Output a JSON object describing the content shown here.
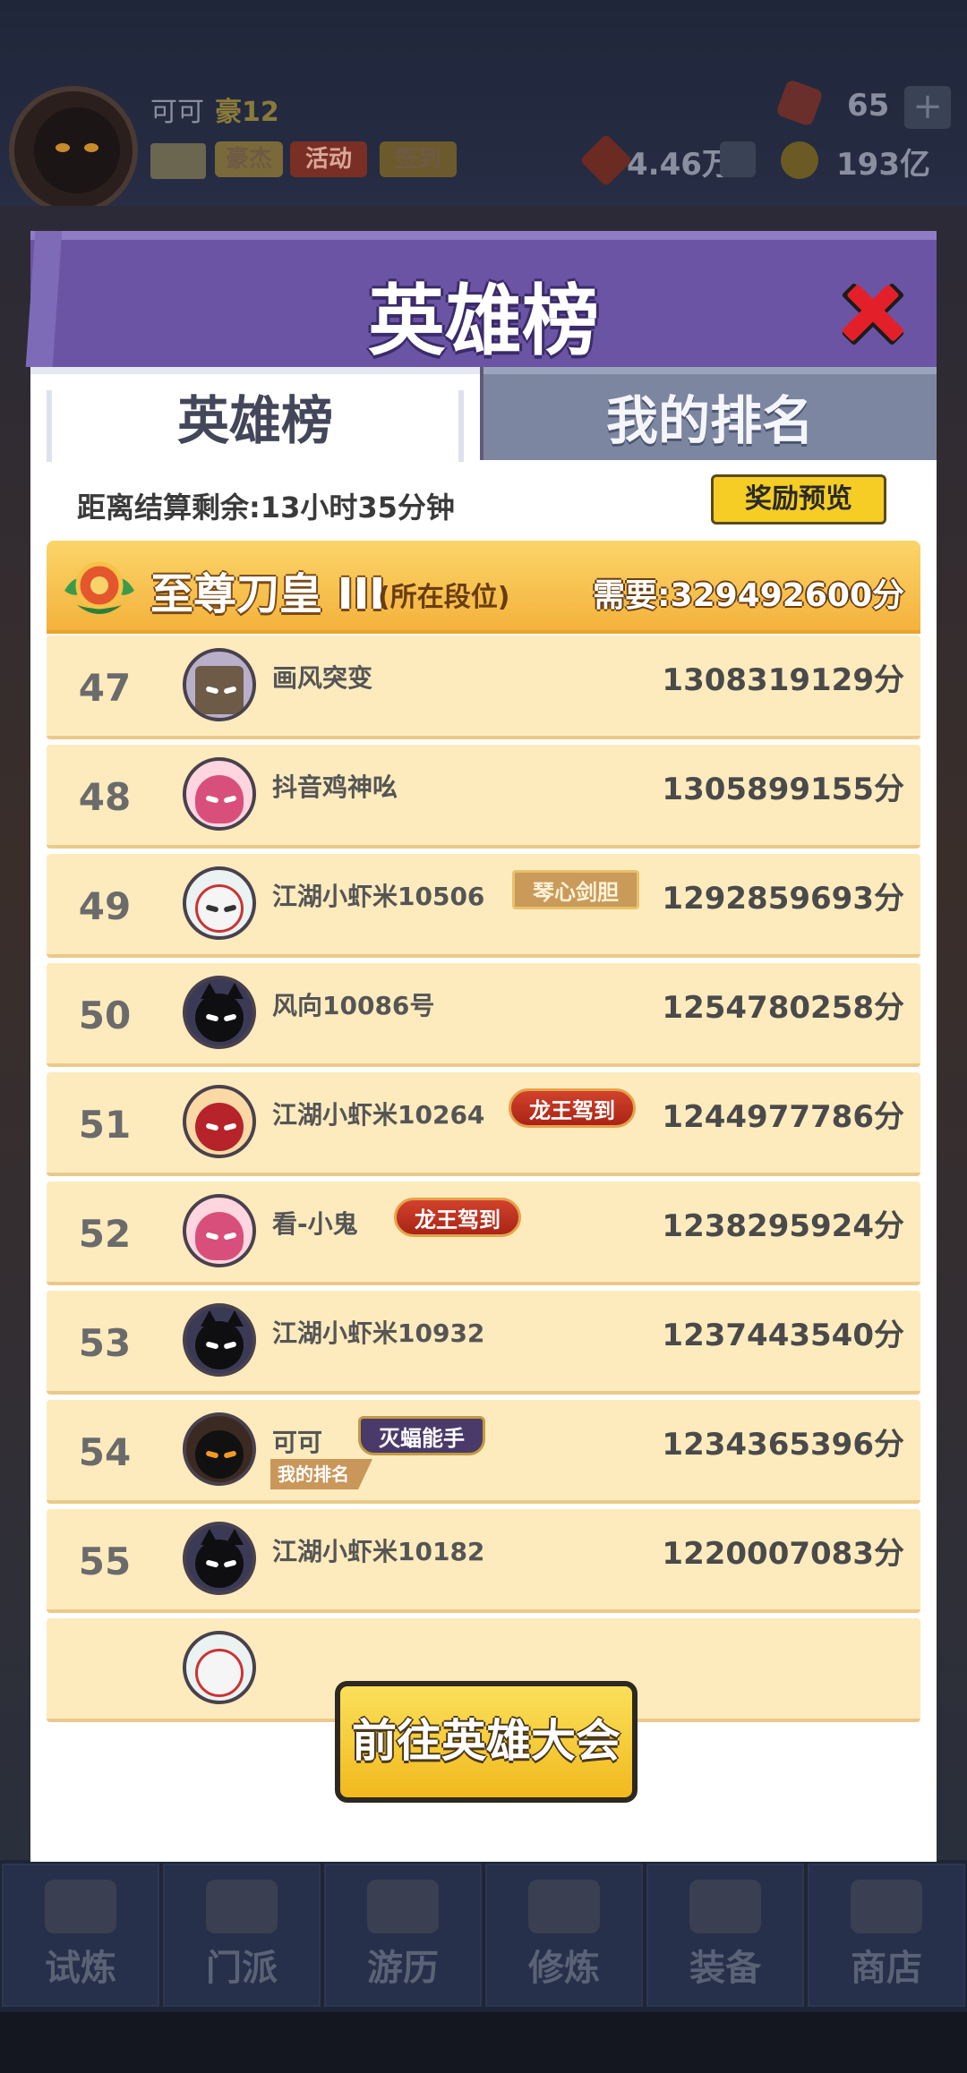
{
  "background": {
    "player_name": "可可",
    "player_level": "豪12",
    "chips": [
      "豪杰",
      "活动",
      "签到"
    ],
    "power": "4.46万",
    "gems": "65",
    "gold": "193亿",
    "plus": "+",
    "bottom_tabs": [
      "试炼",
      "门派",
      "游历",
      "修炼",
      "装备",
      "商店"
    ]
  },
  "modal": {
    "title": "英雄榜",
    "tabs": [
      "英雄榜",
      "我的排名"
    ],
    "settle_text": "距离结算剩余:13小时35分钟",
    "reward_button": "奖励预览",
    "tier": {
      "name": "至尊刀皇 III",
      "sub": "(所在段位)",
      "need": "需要:329492600分"
    },
    "rows": [
      {
        "rank": "47",
        "name": "画风突变",
        "score": "1308319129分",
        "badge": ""
      },
      {
        "rank": "48",
        "name": "抖音鸡神吆",
        "score": "1305899155分",
        "badge": ""
      },
      {
        "rank": "49",
        "name": "江湖小虾米10506",
        "score": "1292859693分",
        "badge": "琴心剑胆"
      },
      {
        "rank": "50",
        "name": "风向10086号",
        "score": "1254780258分",
        "badge": ""
      },
      {
        "rank": "51",
        "name": "江湖小虾米10264",
        "score": "1244977786分",
        "badge": "龙王驾到"
      },
      {
        "rank": "52",
        "name": "看-小鬼",
        "score": "1238295924分",
        "badge": "龙王驾到"
      },
      {
        "rank": "53",
        "name": "江湖小虾米10932",
        "score": "1237443540分",
        "badge": ""
      },
      {
        "rank": "54",
        "name": "可可",
        "score": "1234365396分",
        "badge": "灭蝠能手",
        "tag": "我的排名"
      },
      {
        "rank": "55",
        "name": "江湖小虾米10182",
        "score": "1220007083分",
        "badge": ""
      }
    ],
    "go_button": "前往英雄大会"
  },
  "colors": {
    "header": "#6a54a3",
    "row_bg": "#fdebbe",
    "tier_bar": "#f4b23c",
    "button": "#f5cd24"
  }
}
